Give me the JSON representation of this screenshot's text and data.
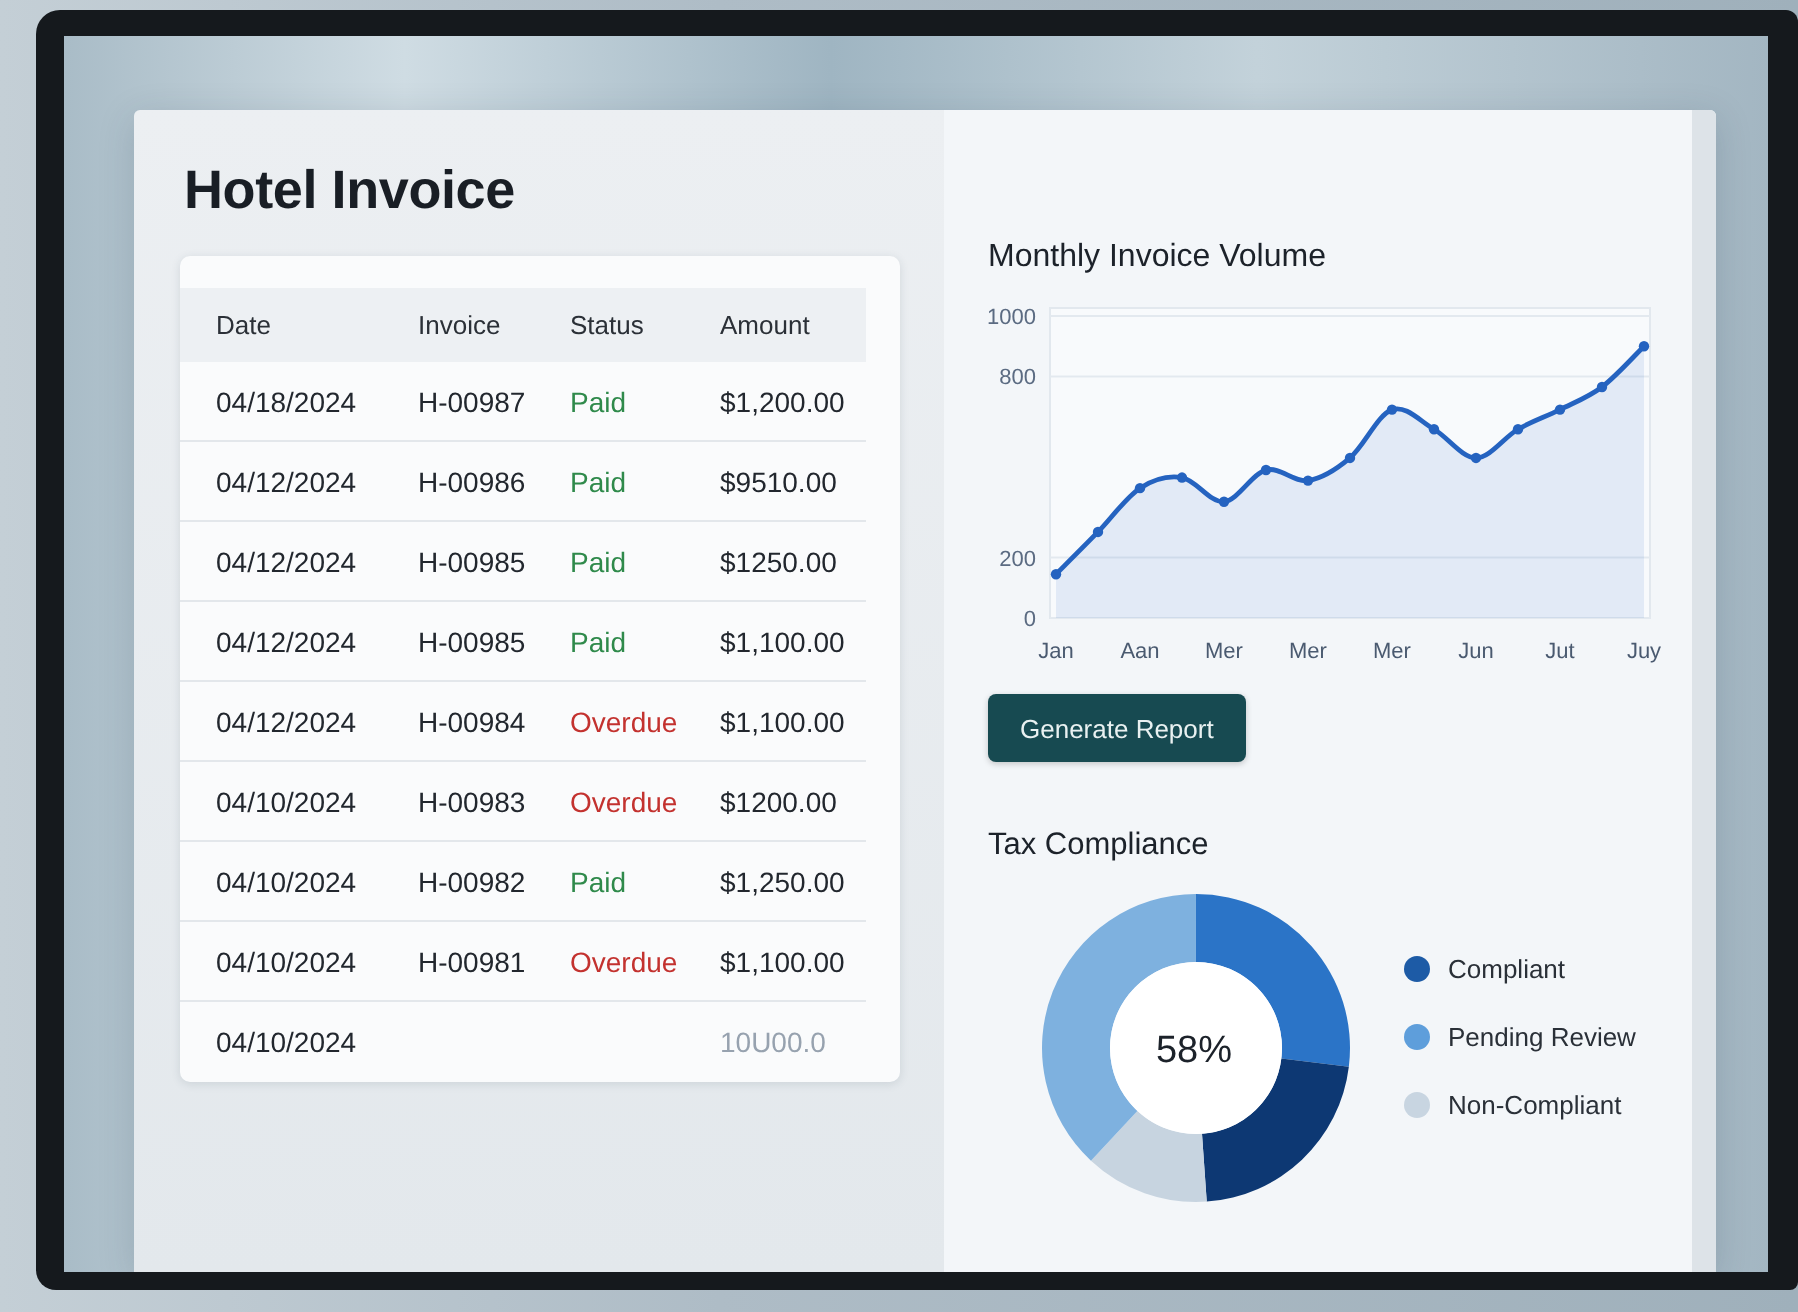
{
  "invoice_panel": {
    "title": "Hotel Invoice"
  },
  "table": {
    "columns": [
      "Date",
      "Invoice",
      "Status",
      "Amount"
    ],
    "rows": [
      {
        "date": "04/18/2024",
        "invoice": "H-00987",
        "status": {
          "label": "Paid",
          "kind": "paid"
        },
        "amount": "$1,200.00",
        "muted": false
      },
      {
        "date": "04/12/2024",
        "invoice": "H-00986",
        "status": {
          "label": "Paid",
          "kind": "paid"
        },
        "amount": "$9510.00",
        "muted": false
      },
      {
        "date": "04/12/2024",
        "invoice": "H-00985",
        "status": {
          "label": "Paid",
          "kind": "paid"
        },
        "amount": "$1250.00",
        "muted": false
      },
      {
        "date": "04/12/2024",
        "invoice": "H-00985",
        "status": {
          "label": "Paid",
          "kind": "paid"
        },
        "amount": "$1,100.00",
        "muted": false
      },
      {
        "date": "04/12/2024",
        "invoice": "H-00984",
        "status": {
          "label": "Overdue",
          "kind": "overdue"
        },
        "amount": "$1,100.00",
        "muted": false
      },
      {
        "date": "04/10/2024",
        "invoice": "H-00983",
        "status": {
          "label": "Overdue",
          "kind": "overdue"
        },
        "amount": "$1200.00",
        "muted": false
      },
      {
        "date": "04/10/2024",
        "invoice": "H-00982",
        "status": {
          "label": "Paid",
          "kind": "paid"
        },
        "amount": "$1,250.00",
        "muted": false
      },
      {
        "date": "04/10/2024",
        "invoice": "H-00981",
        "status": {
          "label": "Overdue",
          "kind": "overdue"
        },
        "amount": "$1,100.00",
        "muted": false
      },
      {
        "date": "04/10/2024",
        "amount": "10U00.0",
        "muted": true
      }
    ]
  },
  "volume_chart": {
    "chart_data": {
      "type": "area",
      "title": "Monthly Invoice Volume",
      "categories": [
        "Jan",
        null,
        "Aan",
        null,
        "Mer",
        null,
        "Mer",
        null,
        "Mer",
        null,
        "Jun",
        null,
        "Jut",
        null,
        "Juy"
      ],
      "series": [
        {
          "color": "#2563c0",
          "values": [
            145,
            285,
            430,
            465,
            385,
            490,
            455,
            530,
            690,
            625,
            530,
            625,
            690,
            765,
            900
          ]
        }
      ],
      "ylim": [
        0,
        1000
      ],
      "yticks": [
        0,
        200,
        800,
        1000
      ]
    }
  },
  "generate_button": {
    "label": "Generate Report"
  },
  "tax_compliance": {
    "title": "Tax Compliance",
    "center_label": "58%",
    "legend": [
      {
        "label": "Compliant",
        "color": "#1d5ba6"
      },
      {
        "label": "Pending Review",
        "color": "#5e9edb"
      },
      {
        "label": "Non-Compliant",
        "color": "#c8d5e1"
      }
    ]
  }
}
